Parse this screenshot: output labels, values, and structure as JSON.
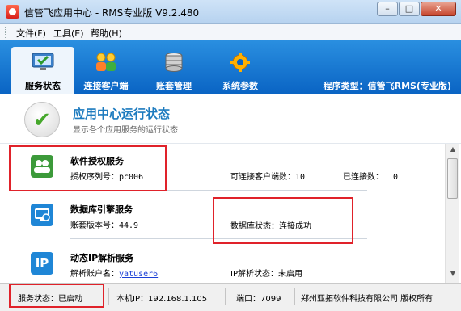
{
  "window": {
    "title": "信管飞应用中心 - RMS专业版 V9.2.480",
    "minimize_glyph": "–",
    "maximize_glyph": "□",
    "close_glyph": "✕"
  },
  "menu": {
    "items": [
      {
        "label": "文件(F)"
      },
      {
        "label": "工具(E)"
      },
      {
        "label": "帮助(H)"
      }
    ]
  },
  "tabs": [
    {
      "label": "服务状态",
      "icon": "monitor-check-icon",
      "active": true
    },
    {
      "label": "连接客户端",
      "icon": "users-icon",
      "active": false
    },
    {
      "label": "账套管理",
      "icon": "database-icon",
      "active": false
    },
    {
      "label": "系统参数",
      "icon": "gear-icon",
      "active": false
    }
  ],
  "program_type": "程序类型：信管飞RMS(专业版)",
  "section": {
    "title": "应用中心运行状态",
    "subtitle": "显示各个应用服务的运行状态"
  },
  "services": [
    {
      "name": "软件授权服务",
      "icon": "users-icon",
      "fields": [
        {
          "label": "授权序列号：",
          "value": "pc006"
        },
        {
          "label": "可连接客户端数：",
          "value": "10"
        },
        {
          "label": "已连接数：",
          "value": "0"
        }
      ]
    },
    {
      "name": "数据库引擎服务",
      "icon": "database-engine-icon",
      "fields": [
        {
          "label": "账套版本号：",
          "value": "44.9"
        },
        {
          "label": "数据库状态：",
          "value": "连接成功"
        }
      ]
    },
    {
      "name": "动态IP解析服务",
      "icon": "ip-icon",
      "icon_text": "IP",
      "fields": [
        {
          "label": "解析账户名：",
          "value": "yatuser6"
        },
        {
          "label": "IP解析状态：",
          "value": "未启用"
        }
      ]
    }
  ],
  "statusbar": {
    "service_status": "服务状态：已启动",
    "local_ip": "本机IP：192.168.1.105",
    "port": "端口：7099",
    "copyright": "郑州亚拓软件科技有限公司 版权所有"
  },
  "colors": {
    "header_blue": "#0a64c4",
    "title_accent": "#1d7bbf",
    "annotation_red": "#e0222a",
    "service_icon_green": "#3c9a3a",
    "service_icon_blue": "#1f86d6"
  }
}
